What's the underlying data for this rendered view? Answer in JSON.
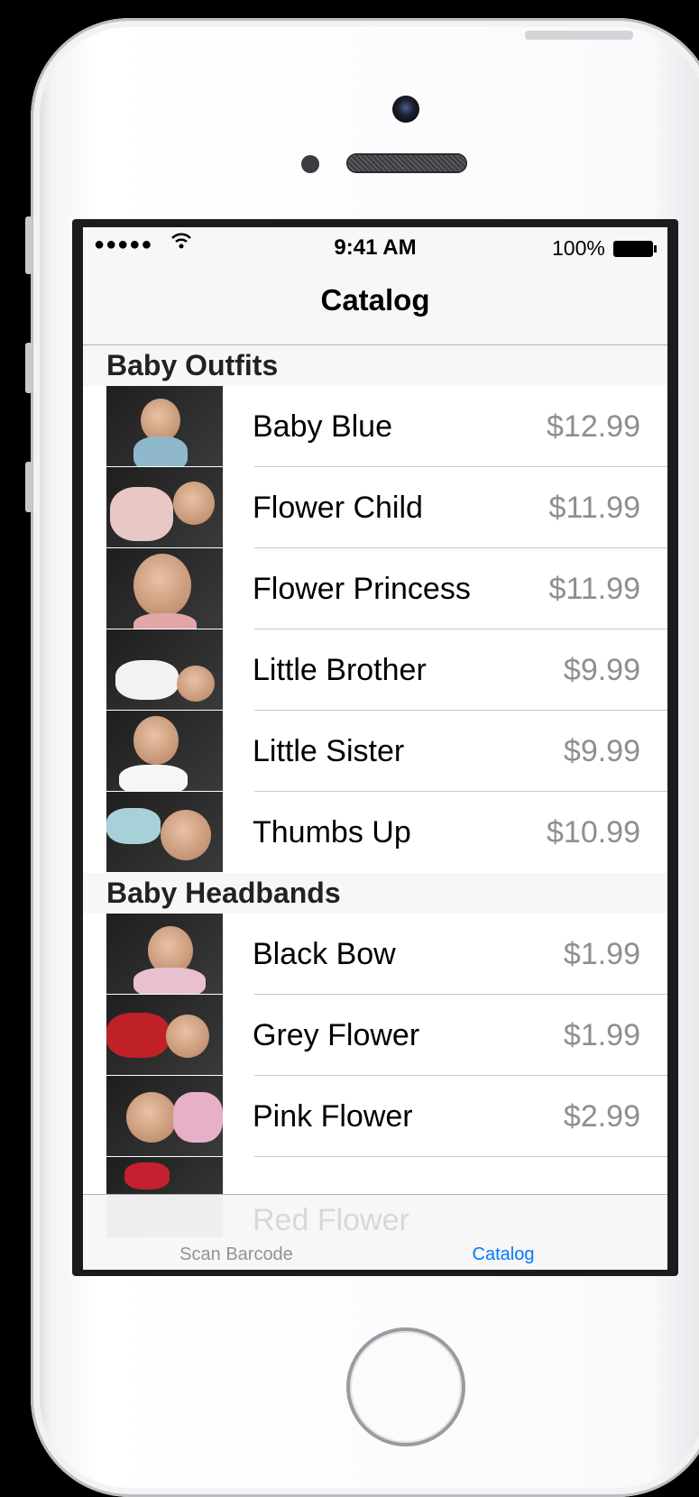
{
  "status_bar": {
    "signal": "●●●●●",
    "wifi_icon": "wifi-icon",
    "time": "9:41 AM",
    "battery": "100%"
  },
  "nav": {
    "title": "Catalog"
  },
  "sections": [
    {
      "title": "Baby Outfits",
      "items": [
        {
          "name": "Baby Blue",
          "price": "$12.99"
        },
        {
          "name": "Flower Child",
          "price": "$11.99"
        },
        {
          "name": "Flower Princess",
          "price": "$11.99"
        },
        {
          "name": "Little Brother",
          "price": "$9.99"
        },
        {
          "name": "Little Sister",
          "price": "$9.99"
        },
        {
          "name": "Thumbs Up",
          "price": "$10.99"
        }
      ]
    },
    {
      "title": "Baby Headbands",
      "items": [
        {
          "name": "Black Bow",
          "price": "$1.99"
        },
        {
          "name": "Grey Flower",
          "price": "$1.99"
        },
        {
          "name": "Pink Flower",
          "price": "$2.99"
        }
      ]
    }
  ],
  "partial_row": {
    "name": "Red Flower"
  },
  "tab_bar": {
    "tabs": [
      {
        "label": "Scan Barcode",
        "selected": false
      },
      {
        "label": "Catalog",
        "selected": true
      }
    ],
    "selected_color": "#007aff",
    "unselected_color": "#929292"
  }
}
